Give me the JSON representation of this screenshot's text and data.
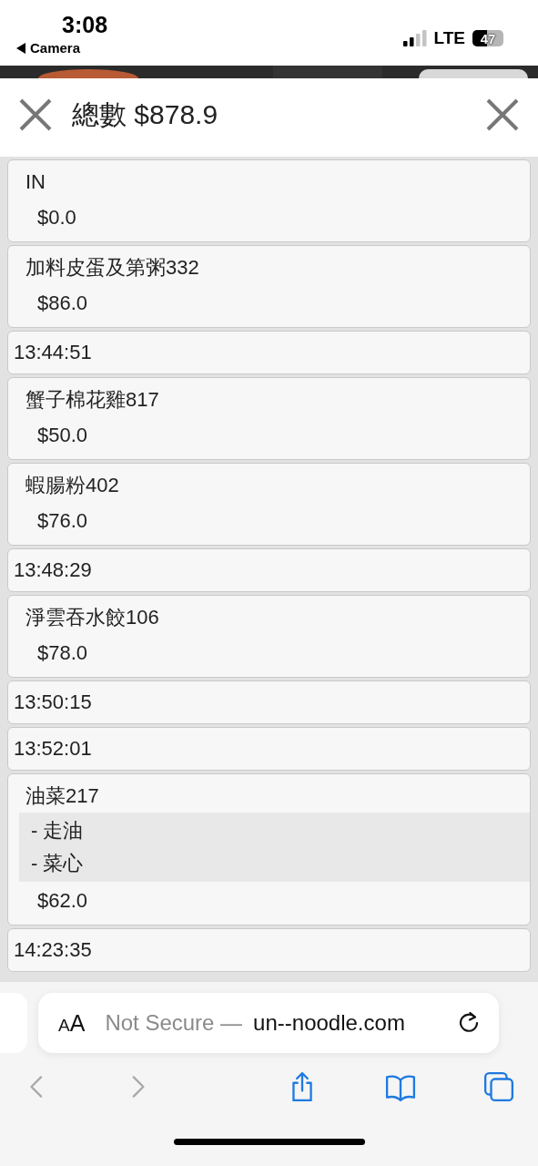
{
  "status_bar": {
    "time": "3:08",
    "back_app": "Camera",
    "network": "LTE",
    "battery": "47"
  },
  "sheet": {
    "title": "總數 $878.9"
  },
  "entries": [
    {
      "kind": "item",
      "name": "IN",
      "price": "$0.0"
    },
    {
      "kind": "item",
      "name": "加料皮蛋及第粥332",
      "price": "$86.0"
    },
    {
      "kind": "time",
      "time": "13:44:51"
    },
    {
      "kind": "item",
      "name": "蟹子棉花雞817",
      "price": "$50.0"
    },
    {
      "kind": "item",
      "name": "蝦腸粉402",
      "price": "$76.0"
    },
    {
      "kind": "time",
      "time": "13:48:29"
    },
    {
      "kind": "item",
      "name": "淨雲吞水餃106",
      "price": "$78.0"
    },
    {
      "kind": "time",
      "time": "13:50:15"
    },
    {
      "kind": "time",
      "time": "13:52:01"
    },
    {
      "kind": "item",
      "name": "油菜217",
      "modifiers": [
        "- 走油",
        "- 菜心"
      ],
      "price": "$62.0"
    },
    {
      "kind": "time",
      "time": "14:23:35"
    }
  ],
  "browser": {
    "text_size_button": "AA",
    "security": "Not Secure —",
    "domain": "un--noodle.com",
    "toolbar": [
      {
        "kind": "back",
        "disabled": true
      },
      {
        "kind": "forward",
        "disabled": true
      },
      {
        "kind": "share",
        "disabled": false
      },
      {
        "kind": "bookmarks",
        "disabled": false
      },
      {
        "kind": "tabs",
        "disabled": false
      }
    ]
  }
}
